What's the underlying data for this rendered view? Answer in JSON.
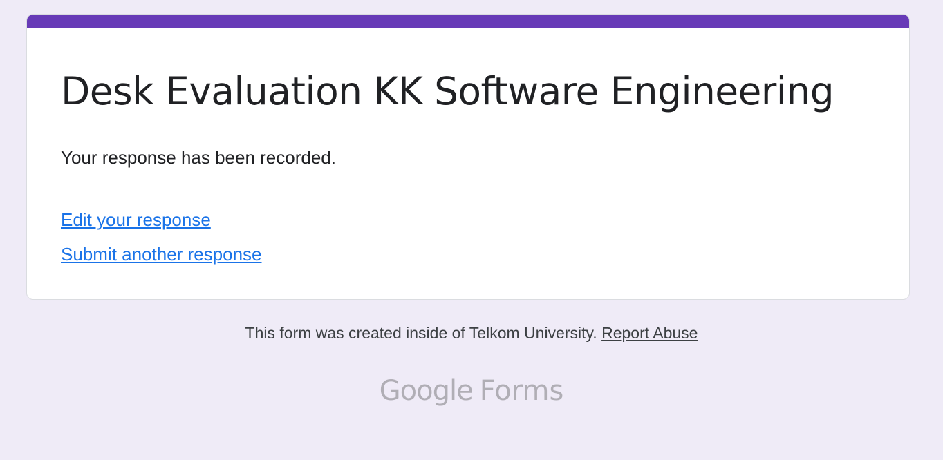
{
  "form": {
    "title": "Desk Evaluation KK Software Engineering",
    "confirmation": "Your response has been recorded.",
    "links": {
      "edit": "Edit your response",
      "submit_another": "Submit another response"
    }
  },
  "footer": {
    "text": "This form was created inside of Telkom University.",
    "report_link": "Report Abuse"
  },
  "branding": {
    "google": "Google",
    "forms": "Forms"
  },
  "colors": {
    "page_background": "#efebf7",
    "accent": "#673ab7",
    "link": "#1a73e8",
    "brand_logo": "#b0aeb5"
  }
}
